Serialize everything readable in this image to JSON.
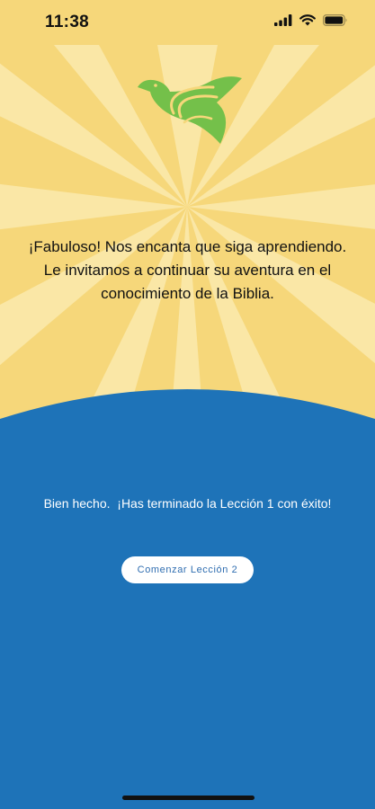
{
  "status_bar": {
    "time": "11:38"
  },
  "colors": {
    "sky": "#f6d77a",
    "rays": "#fae7a6",
    "panel": "#1e73b8",
    "logo_green": "#74c04a"
  },
  "icons": [
    "cellular-signal-icon",
    "wifi-icon",
    "battery-icon",
    "dove-logo-icon"
  ],
  "encouragement": {
    "line1": "¡Fabuloso! Nos encanta que siga aprendiendo.",
    "line2": "Le invitamos a continuar su aventura en el",
    "line3": "conocimiento de la Biblia."
  },
  "completion": {
    "message": "Bien hecho.  ¡Has terminado la Lección 1 con éxito!",
    "button_label": "Comenzar Lección 2"
  }
}
